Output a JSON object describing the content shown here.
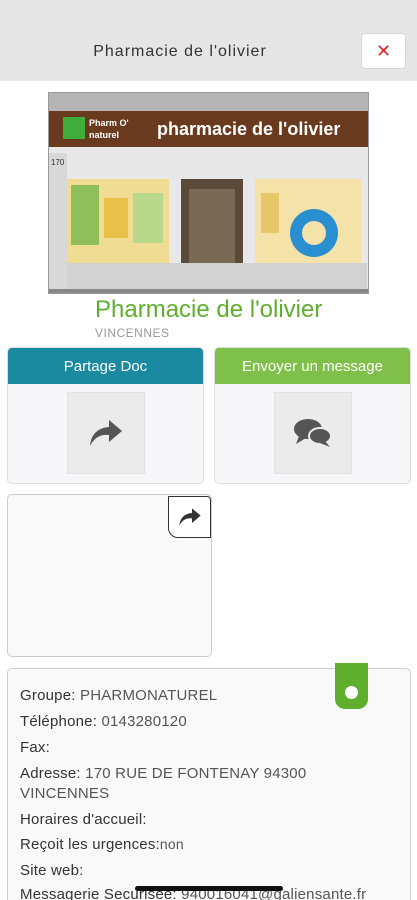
{
  "header": {
    "title": "Pharmacie de l'olivier",
    "close_icon": "close-icon"
  },
  "photo": {
    "sign_brand": "Pharm O' naturel",
    "sign_text": "pharmacie de l'olivier",
    "street_number": "170"
  },
  "pharmacy": {
    "name": "Pharmacie de l'olivier",
    "city": "VINCENNES"
  },
  "cards": [
    {
      "label": "Partage Doc",
      "color": "#1a8aa0",
      "icon": "share-icon"
    },
    {
      "label": "Envoyer un message",
      "color": "#7fc04a",
      "icon": "chat-bubbles-icon"
    }
  ],
  "document": {
    "icon": "share-icon"
  },
  "info": {
    "groupe_label": "Groupe:",
    "groupe_value": "PHARMONATUREL",
    "telephone_label": "Téléphone:",
    "telephone_value": "0143280120",
    "fax_label": "Fax:",
    "adresse_label": "Adresse:",
    "adresse_value_1": "170 RUE DE FONTENAY 94300",
    "adresse_value_2": "VINCENNES",
    "horaires_label": "Horaires d'accueil:",
    "urgences_label": "Reçoit les urgences:",
    "urgences_value": "non",
    "site_label": "Site web:",
    "messagerie_label": "Messagerie Securisée:",
    "messagerie_value": "940016041@galiensante.fr"
  }
}
